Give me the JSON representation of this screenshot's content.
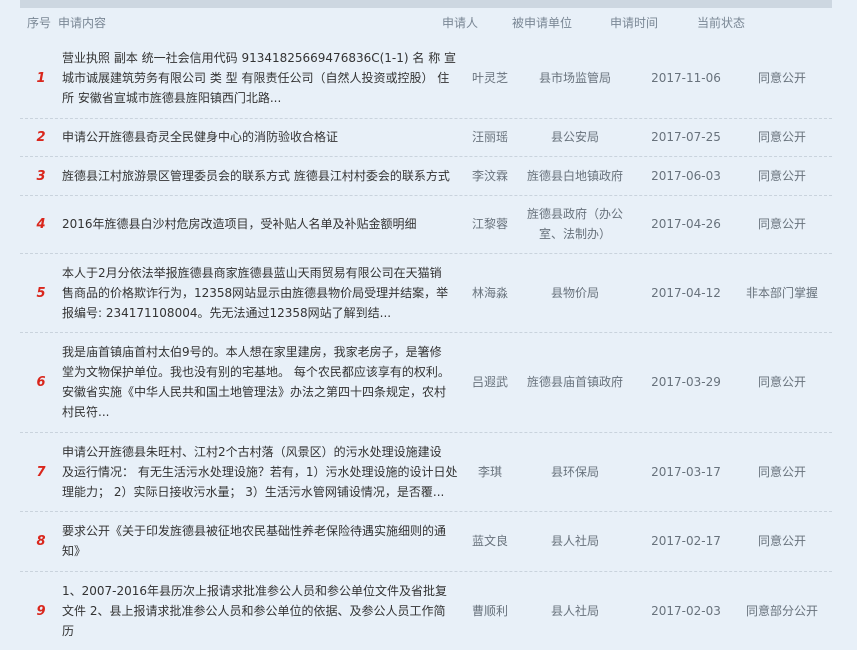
{
  "header": {
    "col_no": "序号",
    "col_content": "申请内容",
    "col_applicant": "申请人",
    "col_unit": "被申请单位",
    "col_time": "申请时间",
    "col_status": "当前状态"
  },
  "rows": [
    {
      "no": "1",
      "content_lines": [
        "营业执照 副本 统一社会信用代码 91341825669476836C(1-1) 名 称 宣",
        "城市诚展建筑劳务有限公司 类 型 有限责任公司（自然人投资或控股） 住",
        "所 安徽省宣城市旌德县旌阳镇西门北路..."
      ],
      "applicant": "叶灵芝",
      "unit_lines": [
        "县市场监管局"
      ],
      "date": "2017-11-06",
      "status": "同意公开"
    },
    {
      "no": "2",
      "content_lines": [
        "申请公开旌德县奇灵全民健身中心的消防验收合格证"
      ],
      "applicant": "汪丽瑶",
      "unit_lines": [
        "县公安局"
      ],
      "date": "2017-07-25",
      "status": "同意公开"
    },
    {
      "no": "3",
      "content_lines": [
        "旌德县江村旅游景区管理委员会的联系方式 旌德县江村村委会的联系方式"
      ],
      "applicant": "李汶霖",
      "unit_lines": [
        "旌德县白地镇政府"
      ],
      "date": "2017-06-03",
      "status": "同意公开"
    },
    {
      "no": "4",
      "content_lines": [
        "2016年旌德县白沙村危房改造项目，受补贴人名单及补贴金额明细"
      ],
      "applicant": "江黎蓉",
      "unit_lines": [
        "旌德县政府（办公",
        "室、法制办）"
      ],
      "date": "2017-04-26",
      "status": "同意公开"
    },
    {
      "no": "5",
      "content_lines": [
        "本人于2月分依法举报旌德县商家旌德县蓝山天雨贸易有限公司在天猫销",
        "售商品的价格欺诈行为，12358网站显示由旌德县物价局受理并结案，举",
        "报编号: 234171108004。先无法通过12358网站了解到结..."
      ],
      "applicant": "林海淼",
      "unit_lines": [
        "县物价局"
      ],
      "date": "2017-04-12",
      "status": "非本部门掌握"
    },
    {
      "no": "6",
      "content_lines": [
        "我是庙首镇庙首村太伯9号的。本人想在家里建房，我家老房子，是箸修",
        "堂为文物保护单位。我也没有别的宅基地。 每个农民都应该享有的权利。",
        "安徽省实施《中华人民共和国土地管理法》办法之第四十四条规定，农村",
        "村民符..."
      ],
      "applicant": "吕遐武",
      "unit_lines": [
        "旌德县庙首镇政府"
      ],
      "date": "2017-03-29",
      "status": "同意公开"
    },
    {
      "no": "7",
      "content_lines": [
        "申请公开旌德县朱旺村、江村2个古村落（风景区）的污水处理设施建设",
        "及运行情况： 有无生活污水处理设施？若有，1）污水处理设施的设计日处",
        "理能力； 2）实际日接收污水量； 3）生活污水管网铺设情况，是否覆..."
      ],
      "applicant": "李琪",
      "unit_lines": [
        "县环保局"
      ],
      "date": "2017-03-17",
      "status": "同意公开"
    },
    {
      "no": "8",
      "content_lines": [
        "要求公开《关于印发旌德县被征地农民基础性养老保险待遇实施细则的通",
        "知》"
      ],
      "applicant": "蓝文良",
      "unit_lines": [
        "县人社局"
      ],
      "date": "2017-02-17",
      "status": "同意公开"
    },
    {
      "no": "9",
      "content_lines": [
        "1、2007-2016年县历次上报请求批准参公人员和参公单位文件及省批复",
        "文件 2、县上报请求批准参公人员和参公单位的依据、及参公人员工作简",
        "历"
      ],
      "applicant": "曹顺利",
      "unit_lines": [
        "县人社局"
      ],
      "date": "2017-02-03",
      "status": "同意部分公开"
    }
  ]
}
